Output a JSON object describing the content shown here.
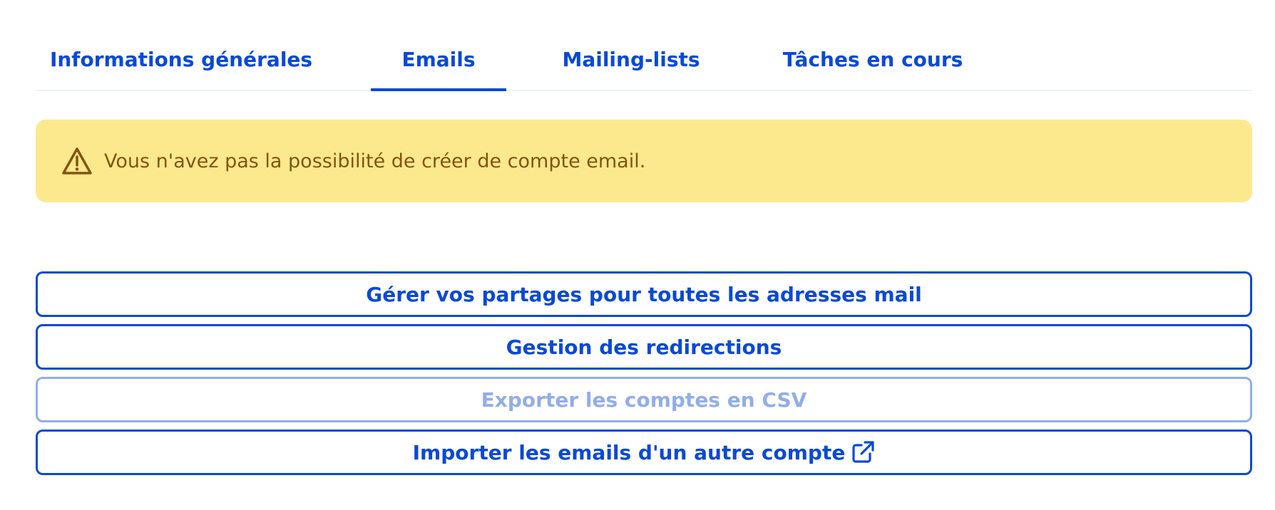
{
  "tabs": [
    {
      "label": "Informations générales",
      "active": false
    },
    {
      "label": "Emails",
      "active": true
    },
    {
      "label": "Mailing-lists",
      "active": false
    },
    {
      "label": "Tâches en cours",
      "active": false
    }
  ],
  "alert": {
    "icon": "warning-triangle-icon",
    "text": "Vous n'avez pas la possibilité de créer de compte email."
  },
  "actions": [
    {
      "label": "Gérer vos partages pour toutes les adresses mail",
      "disabled": false
    },
    {
      "label": "Gestion des redirections",
      "disabled": false
    },
    {
      "label": "Exporter les comptes en CSV",
      "disabled": true
    },
    {
      "label": "Importer les emails d'un autre compte",
      "disabled": false,
      "icon": "external-link-icon"
    }
  ],
  "colors": {
    "primary": "#0a49d6",
    "disabled": "#92aee8",
    "warning_bg": "#fde98d",
    "warning_text": "#845311",
    "tab_border": "#e9f1fb"
  }
}
